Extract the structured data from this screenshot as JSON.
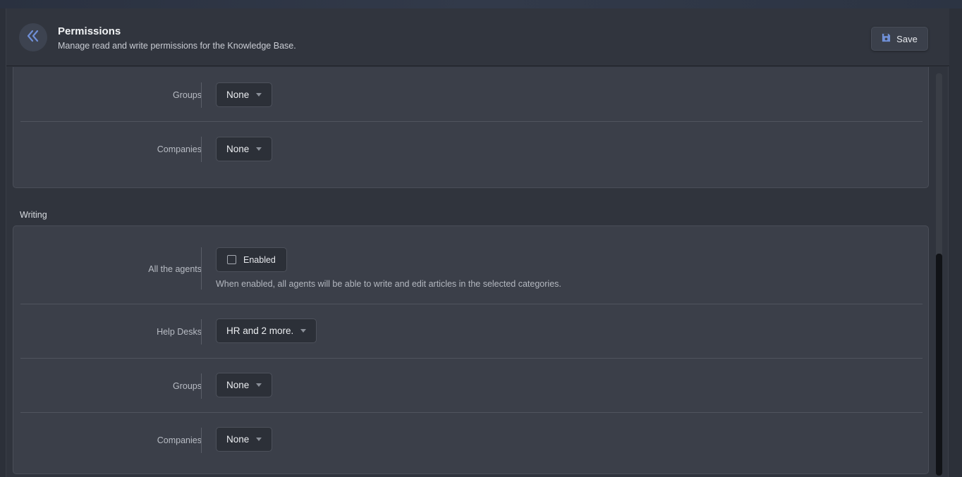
{
  "header": {
    "title": "Permissions",
    "subtitle": "Manage read and write permissions for the Knowledge Base.",
    "save_label": "Save"
  },
  "reading": {
    "rows": [
      {
        "label": "Groups",
        "value": "None"
      },
      {
        "label": "Companies",
        "value": "None"
      }
    ]
  },
  "writing": {
    "title": "Writing",
    "all_agents": {
      "label": "All the agents",
      "toggle_label": "Enabled",
      "checked": false,
      "help": "When enabled, all agents will be able to write and edit articles in the selected categories."
    },
    "rows": [
      {
        "label": "Help Desks",
        "value": "HR and 2 more."
      },
      {
        "label": "Groups",
        "value": "None"
      },
      {
        "label": "Companies",
        "value": "None"
      }
    ]
  },
  "icons": {
    "back": "double-chevron-left-icon",
    "save": "floppy-disk-icon",
    "caret": "caret-down-icon"
  },
  "colors": {
    "accent": "#6f8fd6"
  }
}
